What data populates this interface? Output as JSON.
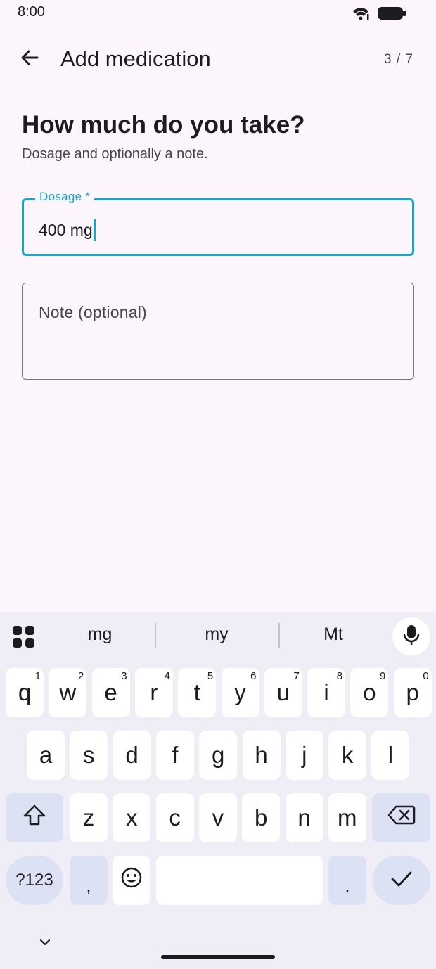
{
  "status": {
    "time": "8:00"
  },
  "app_bar": {
    "title": "Add medication",
    "step": "3 / 7"
  },
  "page": {
    "heading": "How much do you take?",
    "subheading": "Dosage and optionally a note."
  },
  "form": {
    "dosage": {
      "label": "Dosage *",
      "value": "400 mg"
    },
    "note": {
      "placeholder": "Note (optional)"
    }
  },
  "keyboard": {
    "suggestions": [
      "mg",
      "my",
      "Mt"
    ],
    "row1": [
      {
        "k": "q",
        "h": "1"
      },
      {
        "k": "w",
        "h": "2"
      },
      {
        "k": "e",
        "h": "3"
      },
      {
        "k": "r",
        "h": "4"
      },
      {
        "k": "t",
        "h": "5"
      },
      {
        "k": "y",
        "h": "6"
      },
      {
        "k": "u",
        "h": "7"
      },
      {
        "k": "i",
        "h": "8"
      },
      {
        "k": "o",
        "h": "9"
      },
      {
        "k": "p",
        "h": "0"
      }
    ],
    "row2": [
      "a",
      "s",
      "d",
      "f",
      "g",
      "h",
      "j",
      "k",
      "l"
    ],
    "row3": [
      "z",
      "x",
      "c",
      "v",
      "b",
      "n",
      "m"
    ],
    "symbols_label": "?123",
    "comma": ",",
    "period": "."
  },
  "colors": {
    "accent": "#18A5CC",
    "background": "#FCF6FC",
    "keyboard_bg": "#EFEDF6",
    "mod_key": "#DCE1F4"
  },
  "icons": [
    "back-arrow-icon",
    "wifi-icon",
    "battery-icon",
    "apps-grid-icon",
    "mic-icon",
    "shift-icon",
    "backspace-icon",
    "emoji-icon",
    "enter-check-icon",
    "chevron-down-icon"
  ]
}
